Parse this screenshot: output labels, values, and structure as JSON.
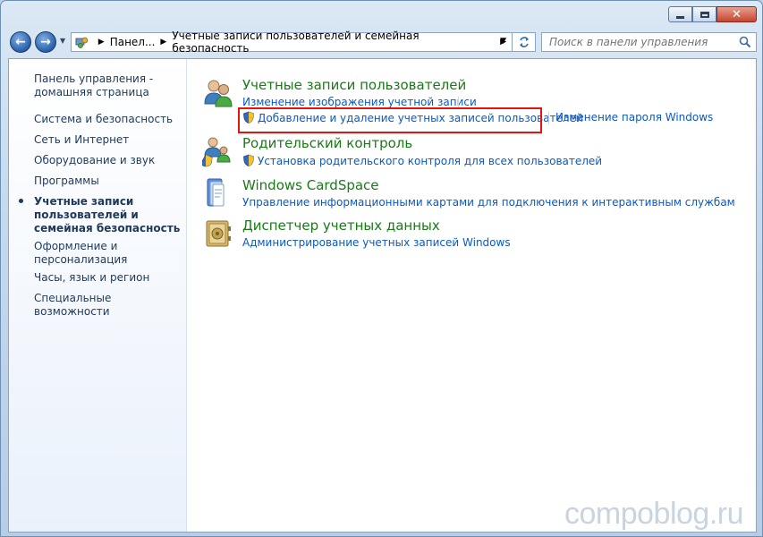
{
  "window": {
    "caption_buttons": [
      "minimize-icon",
      "maximize-icon",
      "close-icon"
    ]
  },
  "navigation": {
    "breadcrumb": [
      "Панел...",
      "Учетные записи пользователей и семейная безопасность"
    ],
    "search_placeholder": "Поиск в панели управления"
  },
  "sidebar": {
    "items": [
      {
        "label": "Панель управления - домашняя страница",
        "current": false
      },
      {
        "label": "Система и безопасность",
        "current": false
      },
      {
        "label": "Сеть и Интернет",
        "current": false
      },
      {
        "label": "Оборудование и звук",
        "current": false
      },
      {
        "label": "Программы",
        "current": false
      },
      {
        "label": "Учетные записи пользователей и семейная безопасность",
        "current": true
      },
      {
        "label": "Оформление и персонализация",
        "current": false
      },
      {
        "label": "Часы, язык и регион",
        "current": false
      },
      {
        "label": "Специальные возможности",
        "current": false
      }
    ]
  },
  "categories": [
    {
      "title": "Учетные записи пользователей",
      "icon": "user-accounts-icon",
      "tasks": [
        "Изменение изображения учетной записи",
        "Добавление и удаление учетных записей пользователей",
        "Изменение пароля Windows"
      ]
    },
    {
      "title": "Родительский контроль",
      "icon": "parental-controls-icon",
      "tasks": [
        "Установка родительского контроля для всех пользователей"
      ]
    },
    {
      "title": "Windows CardSpace",
      "icon": "cardspace-icon",
      "tasks": [
        "Управление информационными картами для подключения к интерактивным службам"
      ]
    },
    {
      "title": "Диспетчер учетных данных",
      "icon": "credential-manager-icon",
      "tasks": [
        "Администрирование учетных записей Windows"
      ]
    }
  ],
  "watermark": "compoblog.ru",
  "colors": {
    "category_title": "#1a7a18",
    "link": "#0a59c4",
    "highlight_box": "#e3150f",
    "sidebar_text": "#1e395b"
  }
}
